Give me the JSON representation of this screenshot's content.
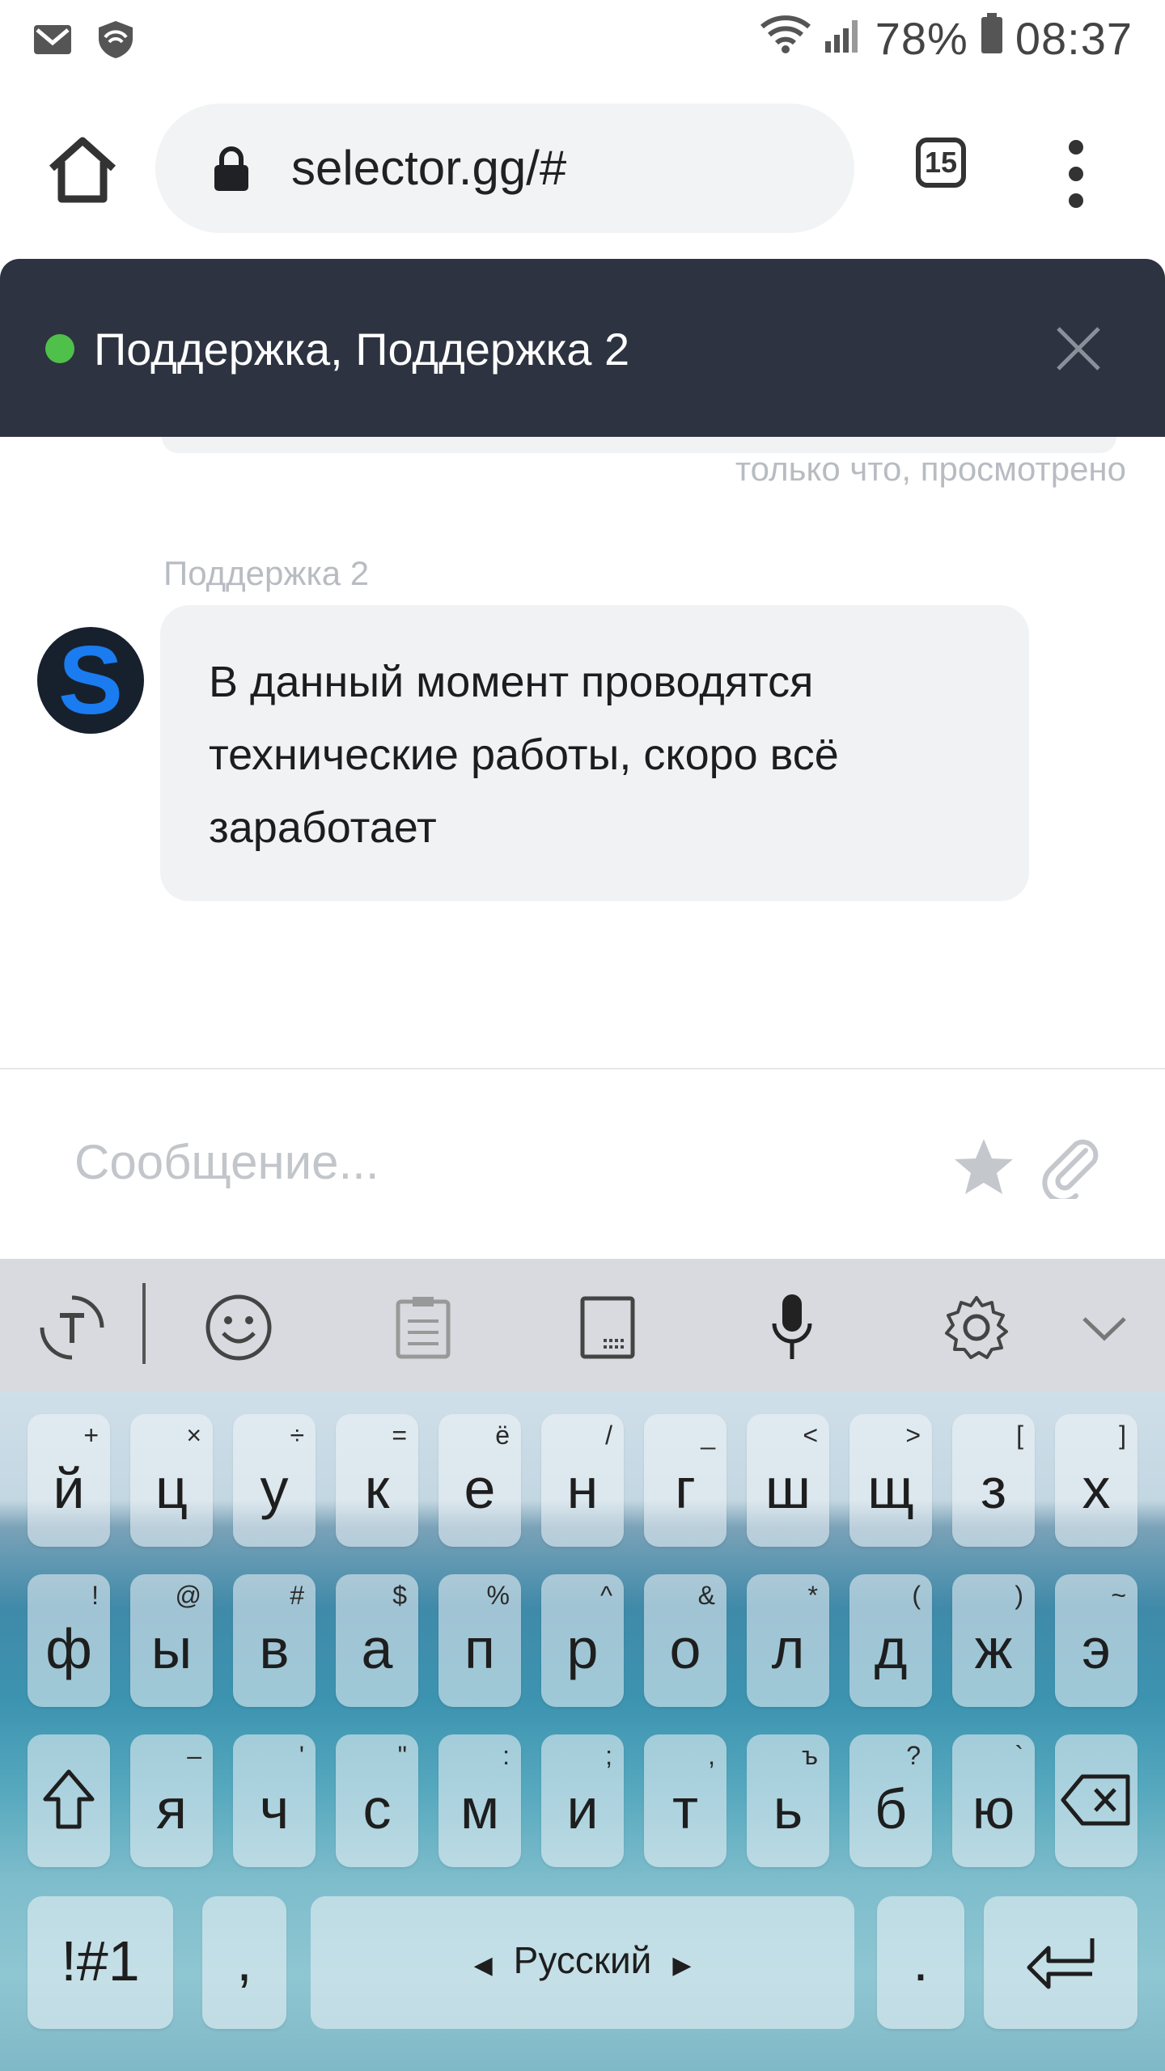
{
  "status_bar": {
    "battery": "78%",
    "time": "08:37",
    "icons": [
      "gmail-icon",
      "shield-icon",
      "wifi-icon",
      "signal-icon",
      "battery-icon"
    ]
  },
  "browser": {
    "url": "selector.gg/#",
    "tab_count": "15"
  },
  "chat": {
    "header_title": "Поддержка, Поддержка 2",
    "online_color": "#4fc04a",
    "read_status": "только что, просмотрено",
    "message": {
      "sender": "Поддержка 2",
      "avatar_letter": "S",
      "text": "В данный момент проводятся технические работы, скоро всё заработает"
    },
    "composer_placeholder": "Сообщение..."
  },
  "keyboard": {
    "row1": [
      {
        "key": "й",
        "sup": "+"
      },
      {
        "key": "ц",
        "sup": "×"
      },
      {
        "key": "у",
        "sup": "÷"
      },
      {
        "key": "к",
        "sup": "="
      },
      {
        "key": "е",
        "sup": "ё"
      },
      {
        "key": "н",
        "sup": "/"
      },
      {
        "key": "г",
        "sup": "_"
      },
      {
        "key": "ш",
        "sup": "<"
      },
      {
        "key": "щ",
        "sup": ">"
      },
      {
        "key": "з",
        "sup": "["
      },
      {
        "key": "х",
        "sup": "]"
      }
    ],
    "row2": [
      {
        "key": "ф",
        "sup": "!"
      },
      {
        "key": "ы",
        "sup": "@"
      },
      {
        "key": "в",
        "sup": "#"
      },
      {
        "key": "а",
        "sup": "$"
      },
      {
        "key": "п",
        "sup": "%"
      },
      {
        "key": "р",
        "sup": "^"
      },
      {
        "key": "о",
        "sup": "&"
      },
      {
        "key": "л",
        "sup": "*"
      },
      {
        "key": "д",
        "sup": "("
      },
      {
        "key": "ж",
        "sup": ")"
      },
      {
        "key": "э",
        "sup": "~"
      }
    ],
    "row3": [
      {
        "key": "я",
        "sup": "–"
      },
      {
        "key": "ч",
        "sup": "'"
      },
      {
        "key": "с",
        "sup": "\""
      },
      {
        "key": "м",
        "sup": ":"
      },
      {
        "key": "и",
        "sup": ";"
      },
      {
        "key": "т",
        "sup": ","
      },
      {
        "key": "ь",
        "sup": "ъ"
      },
      {
        "key": "б",
        "sup": "?"
      },
      {
        "key": "ю",
        "sup": "`"
      }
    ],
    "symbols_key": "!#1",
    "comma_key": ",",
    "space_label": "Русский",
    "period_key": "."
  }
}
